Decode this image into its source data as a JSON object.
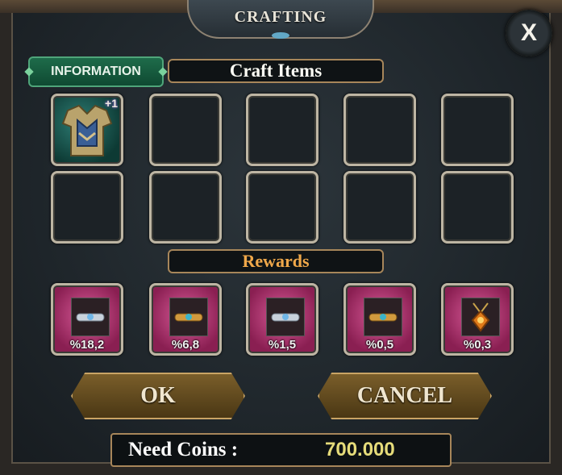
{
  "window": {
    "title": "CRAFTING",
    "close_label": "X"
  },
  "tabs": {
    "information": "INFORMATION",
    "craft_items": "Craft Items"
  },
  "craft_slots": [
    {
      "filled": true,
      "item": "armor-chestplate-icon",
      "badge": "+1"
    },
    {
      "filled": false
    },
    {
      "filled": false
    },
    {
      "filled": false
    },
    {
      "filled": false
    },
    {
      "filled": false
    },
    {
      "filled": false
    },
    {
      "filled": false
    },
    {
      "filled": false
    },
    {
      "filled": false
    }
  ],
  "rewards": {
    "title": "Rewards",
    "items": [
      {
        "icon": "silver-bracelet-icon",
        "chance": "%18,2"
      },
      {
        "icon": "gold-bracelet-icon",
        "chance": "%6,8"
      },
      {
        "icon": "silver-bracelet-icon",
        "chance": "%1,5"
      },
      {
        "icon": "gold-bracelet-icon",
        "chance": "%0,5"
      },
      {
        "icon": "amulet-icon",
        "chance": "%0,3"
      }
    ]
  },
  "buttons": {
    "ok": "OK",
    "cancel": "CANCEL"
  },
  "coins": {
    "label": "Need Coins :",
    "value": "700.000"
  },
  "colors": {
    "reward_bg": "#b8326f",
    "label_border": "#a7865a",
    "coins_value": "#e6dc7a",
    "rewards_text": "#f0a84a"
  }
}
